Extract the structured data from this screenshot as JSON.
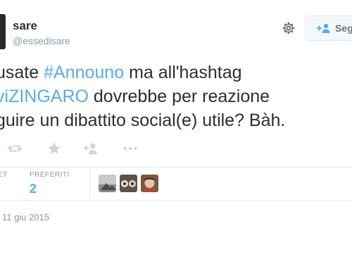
{
  "user": {
    "name": "sare",
    "handle": "@essedisare"
  },
  "follow_label": "Seg",
  "tweet": {
    "line1_pre": "usate ",
    "line1_tag": "#Announo",
    "line1_post": " ma all'hashtag",
    "line2_tag": "viZINGARO",
    "line2_post": " dovrebbe per reazione",
    "line3": "guire un dibattito social(e) utile? Bàh."
  },
  "stats": {
    "retweets_label": "ET",
    "favorites_label": "PREFERITI",
    "favorites_value": "2"
  },
  "date": "11 giu 2015",
  "icons": [
    "reply-icon",
    "retweet-icon",
    "favorite-icon",
    "follow-icon",
    "more-icon",
    "gear-icon"
  ],
  "colors": {
    "accent": "#55acee",
    "icon_gray": "#ccd6dd",
    "text": "#292f33",
    "muted": "#8899a6"
  }
}
